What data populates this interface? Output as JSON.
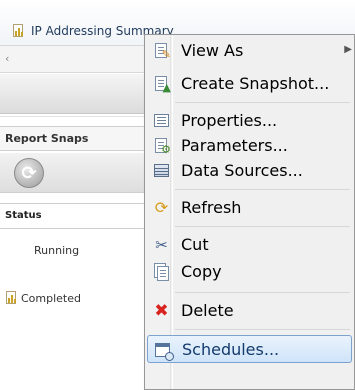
{
  "header": {
    "title": "IP Addressing Summary"
  },
  "panel": {
    "tab_label": "Report Snaps",
    "status_header": "Status",
    "rows": [
      {
        "status": "Running"
      },
      {
        "status": "Completed"
      }
    ]
  },
  "context_menu": {
    "items": [
      {
        "label": "View As",
        "icon": "view-as-icon",
        "has_submenu": true
      },
      {
        "label": "Create Snapshot...",
        "icon": "snapshot-icon"
      },
      {
        "label": "Properties...",
        "icon": "properties-icon"
      },
      {
        "label": "Parameters...",
        "icon": "parameters-icon"
      },
      {
        "label": "Data Sources...",
        "icon": "data-sources-icon"
      },
      {
        "label": "Refresh",
        "icon": "refresh-icon"
      },
      {
        "label": "Cut",
        "icon": "scissors-icon"
      },
      {
        "label": "Copy",
        "icon": "copy-icon"
      },
      {
        "label": "Delete",
        "icon": "delete-icon"
      },
      {
        "label": "Schedules...",
        "icon": "schedules-icon",
        "highlighted": true
      }
    ]
  },
  "colors": {
    "highlight_border": "#7da2ce",
    "delete_red": "#d8231f",
    "report_gold": "#c9a227"
  }
}
